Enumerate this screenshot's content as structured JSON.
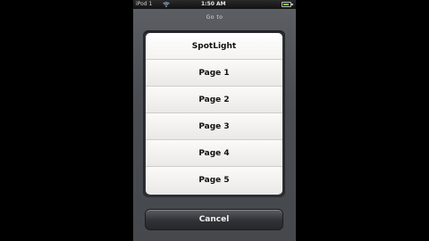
{
  "status_bar": {
    "carrier": "iPod 1",
    "time": "1:50 AM"
  },
  "sheet": {
    "title": "Go to",
    "options": [
      "SpotLight",
      "Page 1",
      "Page 2",
      "Page 3",
      "Page 4",
      "Page 5"
    ],
    "cancel_label": "Cancel"
  },
  "colors": {
    "sheet_bg": "#4a4d52",
    "option_bg": "#f0efee",
    "battery": "#7cc04a"
  }
}
